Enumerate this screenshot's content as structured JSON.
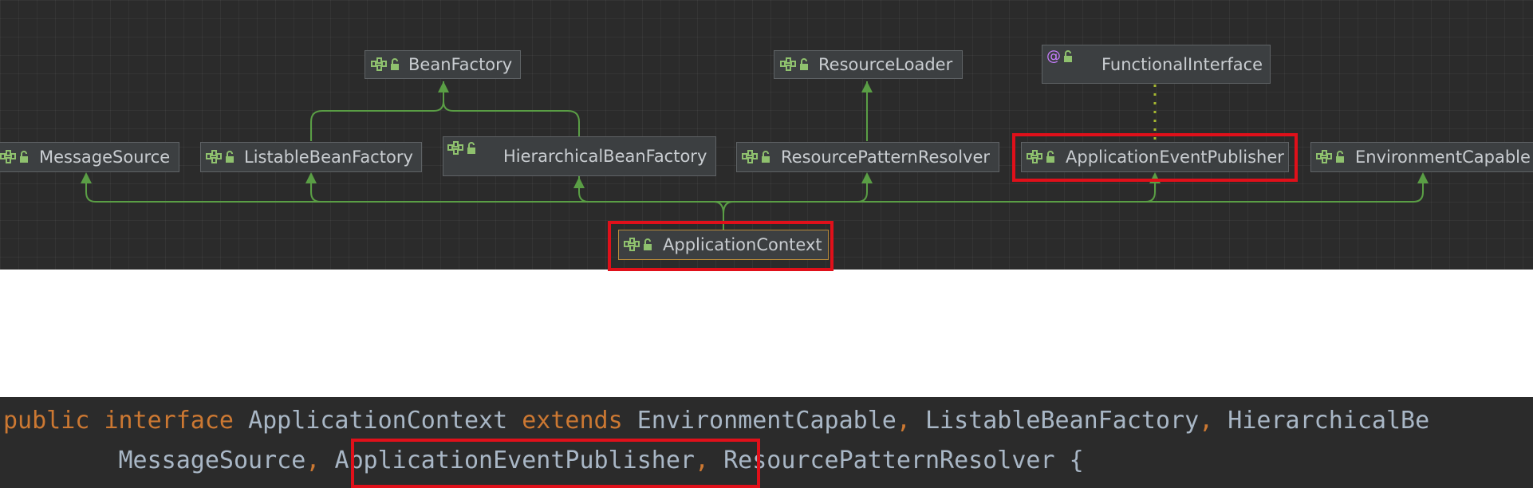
{
  "diagram": {
    "nodes": {
      "bean_factory": "BeanFactory",
      "resource_loader": "ResourceLoader",
      "functional_interface": "FunctionalInterface",
      "message_source": "MessageSource",
      "listable_bean_factory": "ListableBeanFactory",
      "hierarchical_bean_factory": "HierarchicalBeanFactory",
      "resource_pattern_resolver": "ResourcePatternResolver",
      "application_event_publisher": "ApplicationEventPublisher",
      "environment_capable": "EnvironmentCapable",
      "application_context": "ApplicationContext"
    },
    "annotation_symbol": "@",
    "icons": {
      "interface": "interface-icon",
      "visibility": "lock-open-icon",
      "annotation": "annotation-icon"
    },
    "colors": {
      "background": "#2b2b2b",
      "inheritance_edge": "#5a9e45",
      "annotation_edge": "#a6b830",
      "highlight": "#e0101a"
    }
  },
  "code": {
    "line1": {
      "kw_public": "public",
      "kw_interface": "interface",
      "type_name": "ApplicationContext",
      "kw_extends": "extends",
      "t1": "EnvironmentCapable",
      "t2": "ListableBeanFactory",
      "t3": "HierarchicalBe"
    },
    "line2": {
      "t1": "MessageSource",
      "t2": "ApplicationEventPublisher",
      "t3": "ResourcePatternResolver",
      "brace": "{"
    },
    "comma": ",",
    "colors": {
      "keyword": "#cc7832",
      "text": "#a9b7c6"
    }
  }
}
